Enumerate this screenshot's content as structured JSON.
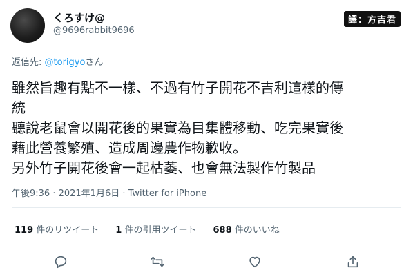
{
  "user": {
    "display_name": "くろすけ@",
    "handle": "@9696rabbit9696"
  },
  "watermark": "譯：方吉君",
  "reply": {
    "prefix": "返信先: ",
    "mention": "@torigyo",
    "suffix": "さん"
  },
  "tweet": {
    "lines": [
      "雖然旨趣有點不一樣、不過有竹子開花不吉利這樣的傳",
      "統",
      "聽說老鼠會以開花後的果實為目集體移動、吃完果實後",
      "藉此營養繁殖、造成周邊農作物歉收。",
      "另外竹子開花後會一起枯萎、也會無法製作竹製品"
    ]
  },
  "meta": "午後9:36 · 2021年1月6日 · Twitter for iPhone",
  "stats": {
    "retweets": "119",
    "retweets_label": "件のリツイート",
    "quotes": "1",
    "quotes_label": "件の引用ツイート",
    "likes": "688",
    "likes_label": "件のいいね"
  },
  "icons": {
    "reply": "reply-icon",
    "retweet": "retweet-icon",
    "like": "heart-icon",
    "share": "share-icon"
  },
  "colors": {
    "link": "#1d9bf0",
    "secondary_text": "#536471",
    "primary_text": "#0f1419"
  }
}
